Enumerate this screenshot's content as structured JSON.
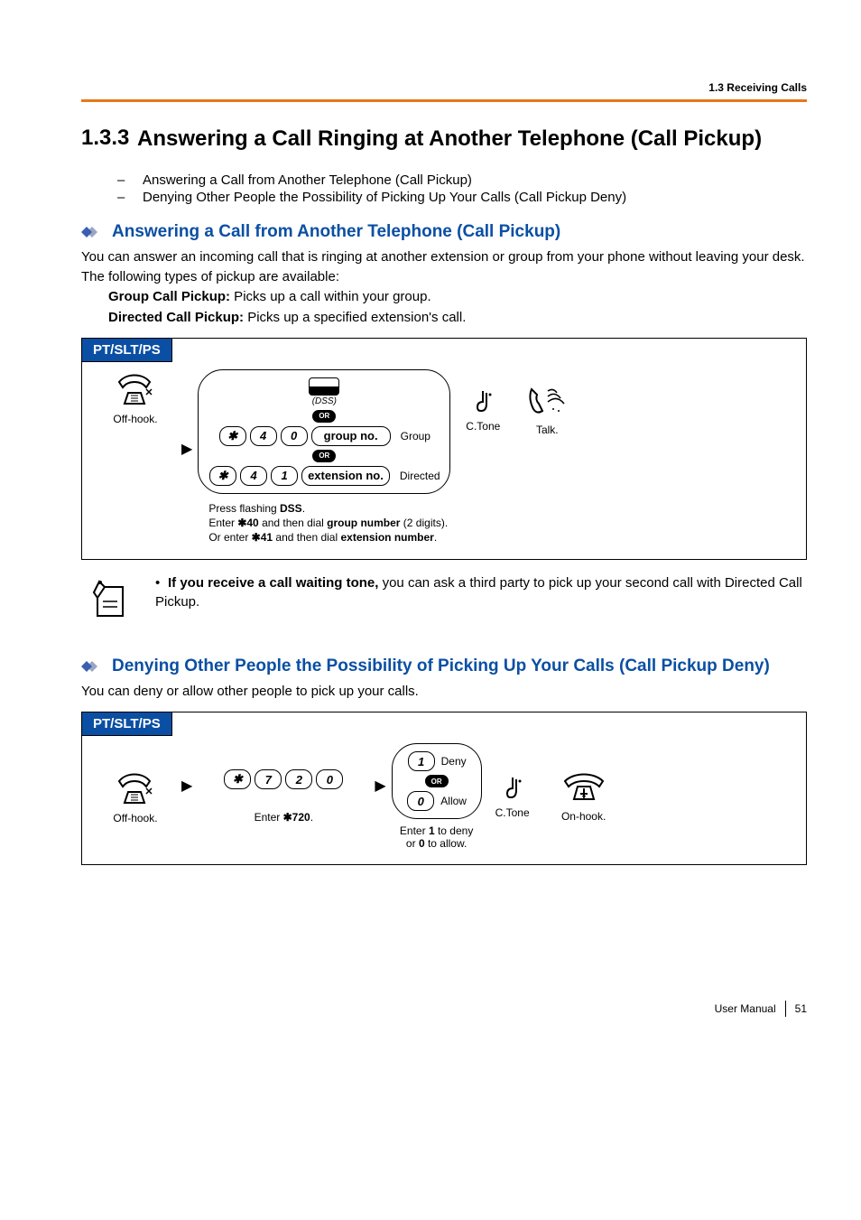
{
  "running_header": "1.3 Receiving Calls",
  "section": {
    "number": "1.3.3",
    "title": "Answering a Call Ringing at Another Telephone (Call Pickup)"
  },
  "toc": [
    "Answering a Call from Another Telephone (Call Pickup)",
    "Denying Other People the Possibility of Picking Up Your Calls (Call Pickup Deny)"
  ],
  "sub1": {
    "heading": "Answering a Call from Another Telephone (Call Pickup)",
    "intro1": "You can answer an incoming call that is ringing at another extension or group from your phone without leaving your desk.",
    "intro2": "The following types of pickup are available:",
    "group_b": "Group Call Pickup:",
    "group_t": " Picks up a call within your group.",
    "direct_b": "Directed Call Pickup:",
    "direct_t": " Picks up a specified extension's call.",
    "tab": "PT/SLT/PS",
    "offhook": "Off-hook.",
    "dss_lbl": "(DSS)",
    "or": "OR",
    "k_star": "✱",
    "k_4": "4",
    "k_0": "0",
    "k_1": "1",
    "groupno_btn": "group no.",
    "extno_btn": "extension no.",
    "group_side": "Group",
    "directed_side": "Directed",
    "ctone": "C.Tone",
    "talk": "Talk.",
    "cap1": "Press flashing ",
    "cap1b": "DSS",
    "cap1c": ".",
    "cap2a": "Enter ",
    "cap2b": "✱40",
    "cap2c": " and then dial ",
    "cap2d": "group number",
    "cap2e": " (2 digits).",
    "cap3a": "Or enter ",
    "cap3b": "✱41",
    "cap3c": " and then dial ",
    "cap3d": "extension number",
    "cap3e": "."
  },
  "note": {
    "lead_b": "If you receive a call waiting tone,",
    "rest": " you can ask a third party to pick up your second call with Directed Call Pickup."
  },
  "sub2": {
    "heading": "Denying Other People the Possibility of Picking Up Your Calls (Call Pickup Deny)",
    "intro": "You can deny or allow other people to pick up your calls.",
    "tab": "PT/SLT/PS",
    "offhook": "Off-hook.",
    "k_star": "✱",
    "k_7": "7",
    "k_2": "2",
    "k_0": "0",
    "k_1": "1",
    "deny": "Deny",
    "allow": "Allow",
    "or": "OR",
    "enter720_a": "Enter ",
    "enter720_b": "✱720",
    "enter720_c": ".",
    "cap_a": "Enter ",
    "cap_b": "1",
    "cap_c": " to deny",
    "cap_d": "or ",
    "cap_e": "0",
    "cap_f": " to allow.",
    "ctone": "C.Tone",
    "onhook": "On-hook."
  },
  "footer": {
    "label": "User Manual",
    "page": "51"
  }
}
